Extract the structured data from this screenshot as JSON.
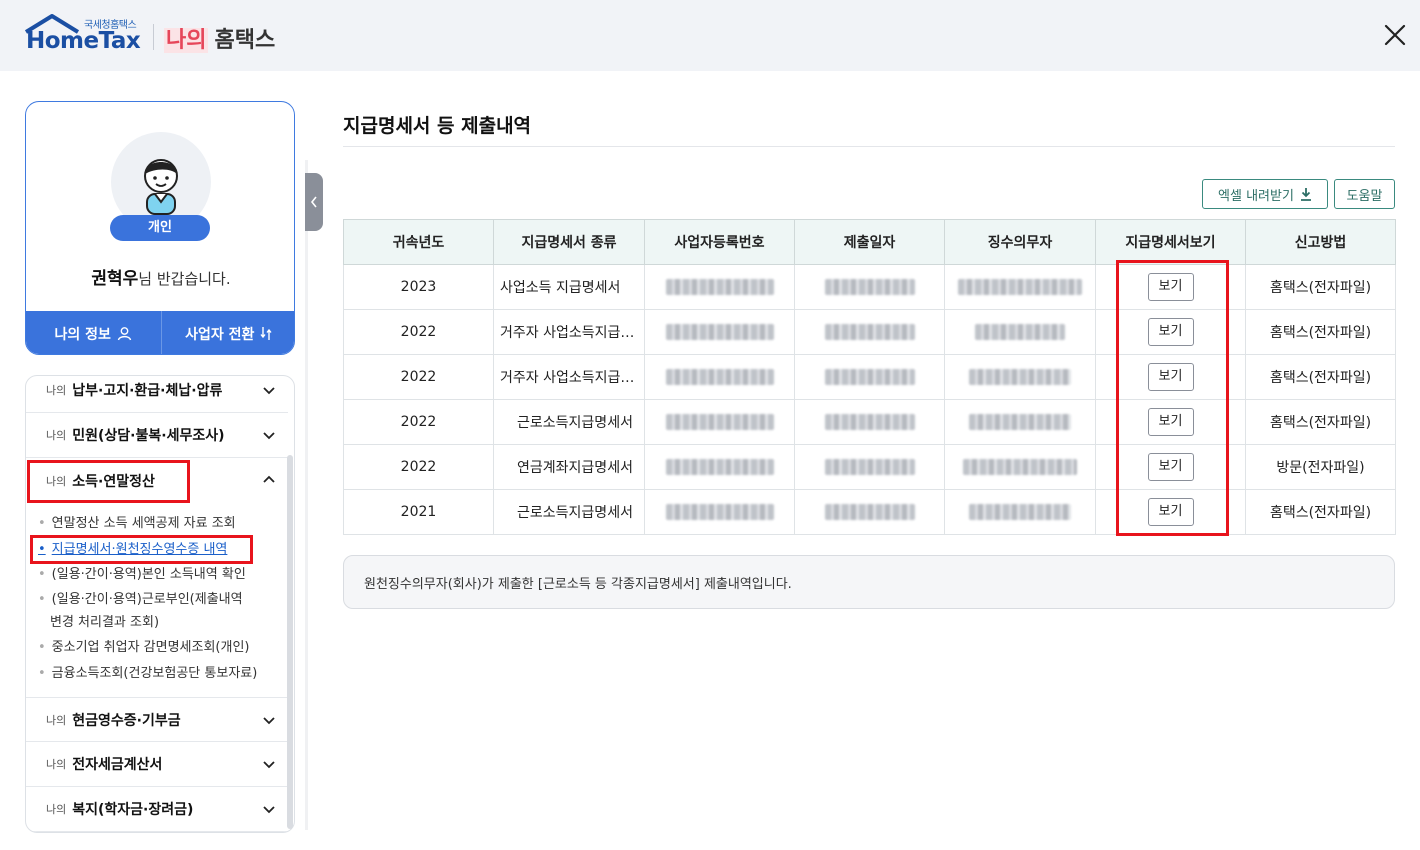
{
  "header": {
    "logo_small": "국세청홈택스",
    "logo_main": "HomeTax",
    "my_prefix": "나의",
    "my_title": "홈택스"
  },
  "profile": {
    "badge": "개인",
    "user_name": "권혁우",
    "greeting_suffix": "님 반갑습니다.",
    "my_info_label": "나의 정보",
    "switch_label": "사업자 전환"
  },
  "menu": {
    "prefix": "나의",
    "items": [
      {
        "label": "납부·고지·환급·체납·압류"
      },
      {
        "label": "민원(상담·불복·세무조사)"
      },
      {
        "label": "소득·연말정산"
      },
      {
        "label": "현금영수증·기부금"
      },
      {
        "label": "전자세금계산서"
      },
      {
        "label": "복지(학자금·장려금)"
      }
    ],
    "sub_items": [
      {
        "label": "연말정산 소득 세액공제 자료 조회"
      },
      {
        "label": "지급명세서·원천징수영수증 내역"
      },
      {
        "label": "(일용·간이·용역)본인 소득내역 확인"
      },
      {
        "label": "(일용·간이·용역)근로부인(제출내역"
      },
      {
        "label": "변경 처리결과 조회)"
      },
      {
        "label": "중소기업 취업자 감면명세조회(개인)"
      },
      {
        "label": "금융소득조회(건강보험공단 통보자료)"
      }
    ]
  },
  "content": {
    "title": "지급명세서 등 제출내역",
    "excel_label": "엑셀 내려받기",
    "help_label": "도움말",
    "columns": [
      "귀속년도",
      "지급명세서 종류",
      "사업자등록번호",
      "제출일자",
      "징수의무자",
      "지급명세서보기",
      "신고방법"
    ],
    "view_label": "보기",
    "rows": [
      {
        "year": "2023",
        "kind": "사업소득 지급명세서",
        "method": "홈택스(전자파일)"
      },
      {
        "year": "2022",
        "kind": "거주자 사업소득지급명세서",
        "method": "홈택스(전자파일)"
      },
      {
        "year": "2022",
        "kind": "거주자 사업소득지급명세서",
        "method": "홈택스(전자파일)"
      },
      {
        "year": "2022",
        "kind": "근로소득지급명세서",
        "method": "홈택스(전자파일)"
      },
      {
        "year": "2022",
        "kind": "연금계좌지급명세서",
        "method": "방문(전자파일)"
      },
      {
        "year": "2021",
        "kind": "근로소득지급명세서",
        "method": "홈택스(전자파일)"
      }
    ],
    "note": "원천징수의무자(회사)가 제출한 [근로소득 등 각종지급명세서] 제출내역입니다."
  },
  "colors": {
    "primary_blue": "#3a73dc",
    "highlight_red": "#e8141c",
    "table_header_bg": "#eef6f5",
    "teal_button": "#2c6e65"
  }
}
